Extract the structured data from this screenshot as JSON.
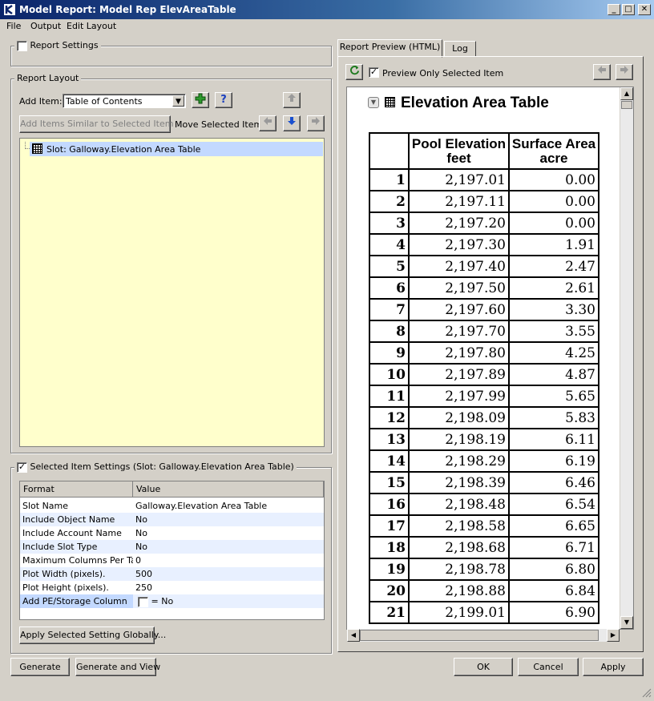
{
  "window": {
    "title": "Model Report: Model Rep ElevAreaTable"
  },
  "menu": [
    "File",
    "Output",
    "Edit Layout"
  ],
  "report_settings": {
    "label": "Report Settings",
    "checked": false
  },
  "report_layout": {
    "group_title": "Report Layout",
    "add_item_label": "Add Item:",
    "add_item_value": "Table of Contents",
    "add_similar_label": "Add Items Similar to Selected Item ...",
    "move_selected_label": "Move Selected Item:",
    "tree_item": "Slot: Galloway.Elevation Area Table"
  },
  "selected_settings": {
    "title": "Selected Item Settings (Slot: Galloway.Elevation Area Table)",
    "checked": true,
    "columns": [
      "Format",
      "Value"
    ],
    "rows": [
      {
        "format": "Slot Name",
        "value": "Galloway.Elevation Area Table"
      },
      {
        "format": "Include Object Name",
        "value": "No"
      },
      {
        "format": "Include Account Name",
        "value": "No"
      },
      {
        "format": "Include Slot Type",
        "value": "No"
      },
      {
        "format": "Maximum Columns Per Table",
        "value": "0"
      },
      {
        "format": "Plot Width (pixels).",
        "value": "500"
      },
      {
        "format": "Plot Height (pixels).",
        "value": "250"
      },
      {
        "format": "Add PE/Storage Column",
        "value": "= No"
      }
    ],
    "apply_globally_label": "Apply Selected Setting Globally..."
  },
  "tabs": [
    "Report Preview (HTML)",
    "Log"
  ],
  "preview": {
    "only_selected_label": "Preview Only Selected Item",
    "only_selected_checked": true,
    "heading": "Elevation Area Table",
    "col_headers": [
      "Pool Elevation",
      "feet",
      "Surface Area",
      "acre"
    ],
    "rows": [
      [
        "1",
        "2,197.01",
        "0.00"
      ],
      [
        "2",
        "2,197.11",
        "0.00"
      ],
      [
        "3",
        "2,197.20",
        "0.00"
      ],
      [
        "4",
        "2,197.30",
        "1.91"
      ],
      [
        "5",
        "2,197.40",
        "2.47"
      ],
      [
        "6",
        "2,197.50",
        "2.61"
      ],
      [
        "7",
        "2,197.60",
        "3.30"
      ],
      [
        "8",
        "2,197.70",
        "3.55"
      ],
      [
        "9",
        "2,197.80",
        "4.25"
      ],
      [
        "10",
        "2,197.89",
        "4.87"
      ],
      [
        "11",
        "2,197.99",
        "5.65"
      ],
      [
        "12",
        "2,198.09",
        "5.83"
      ],
      [
        "13",
        "2,198.19",
        "6.11"
      ],
      [
        "14",
        "2,198.29",
        "6.19"
      ],
      [
        "15",
        "2,198.39",
        "6.46"
      ],
      [
        "16",
        "2,198.48",
        "6.54"
      ],
      [
        "17",
        "2,198.58",
        "6.65"
      ],
      [
        "18",
        "2,198.68",
        "6.71"
      ],
      [
        "19",
        "2,198.78",
        "6.80"
      ],
      [
        "20",
        "2,198.88",
        "6.84"
      ],
      [
        "21",
        "2,199.01",
        "6.90"
      ]
    ]
  },
  "footer": {
    "generate": "Generate",
    "generate_view": "Generate and View",
    "ok": "OK",
    "cancel": "Cancel",
    "apply": "Apply"
  }
}
